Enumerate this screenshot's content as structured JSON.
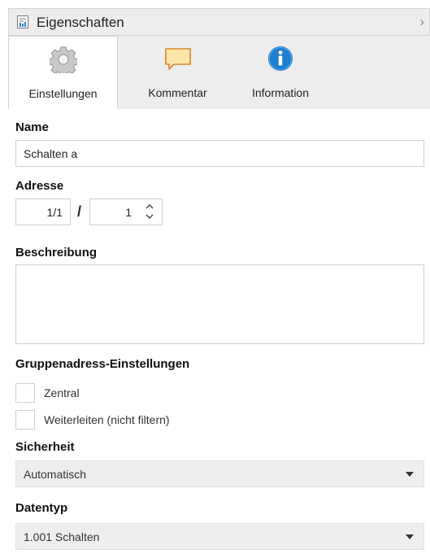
{
  "header": {
    "title": "Eigenschaften",
    "icon": "properties-icon",
    "chevron": "›"
  },
  "tabs": [
    {
      "label": "Einstellungen",
      "icon": "gear-icon",
      "active": true
    },
    {
      "label": "Kommentar",
      "icon": "comment-icon",
      "active": false
    },
    {
      "label": "Information",
      "icon": "info-icon",
      "active": false
    }
  ],
  "form": {
    "name_label": "Name",
    "name_value": "Schalten a",
    "address_label": "Adresse",
    "address_main": "1/1",
    "address_separator": "/",
    "address_sub": "1",
    "description_label": "Beschreibung",
    "description_value": "",
    "group_settings_label": "Gruppenadress-Einstellungen",
    "checkbox_central_label": "Zentral",
    "checkbox_central_checked": false,
    "checkbox_forward_label": "Weiterleiten (nicht filtern)",
    "checkbox_forward_checked": false,
    "security_label": "Sicherheit",
    "security_value": "Automatisch",
    "datatype_label": "Datentyp",
    "datatype_value": "1.001 Schalten"
  },
  "colors": {
    "tab_bar_bg": "#ededed",
    "info_blue": "#1e7fd0",
    "comment_orange": "#e8a23a",
    "select_bg": "#eeeeee"
  }
}
